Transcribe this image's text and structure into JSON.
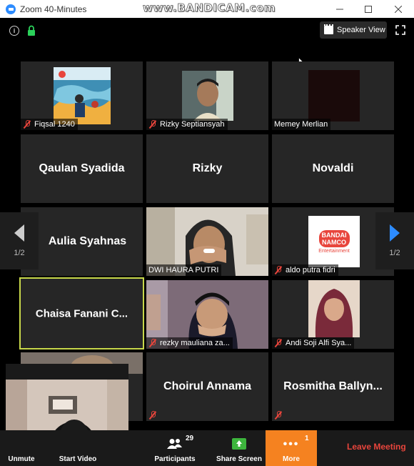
{
  "window": {
    "title": "Zoom 40-Minutes",
    "watermark": "www.BANDICAM.com"
  },
  "top_controls": {
    "speaker_view_label": "Speaker View"
  },
  "pager": {
    "left_label": "1/2",
    "right_label": "1/2"
  },
  "participants": [
    {
      "name": "Fiqsal 1240",
      "muted": true,
      "video": true
    },
    {
      "name": "Rizky Septiansyah",
      "muted": true,
      "video": true
    },
    {
      "name": "Memey Merlian",
      "muted": false,
      "video": true
    },
    {
      "name": "Qaulan Syadida",
      "video": false
    },
    {
      "name": "Rizky",
      "video": false
    },
    {
      "name": "Novaldi",
      "video": false
    },
    {
      "name": "Aulia Syahnas",
      "video": false
    },
    {
      "name": "DWI HAURA PUTRI",
      "muted": false,
      "video": true
    },
    {
      "name": "aldo putra fidri",
      "muted": true,
      "video": true
    },
    {
      "name": "Chaisa Fanani C...",
      "video": false,
      "active_speaker": true
    },
    {
      "name": "rezky mauliana za...",
      "muted": true,
      "video": true
    },
    {
      "name": "Andi Soji Alfi Sya...",
      "muted": true,
      "video": true
    },
    {
      "name": "Choirul Annama",
      "video": false,
      "muted": true
    },
    {
      "name": "Rosmitha Ballyn...",
      "video": false,
      "muted": true
    }
  ],
  "logo_text": {
    "line1": "BANDAI",
    "line2": "NAMCO",
    "line3": "Entertainment"
  },
  "toolbar": {
    "unmute_label": "Unmute",
    "start_video_label": "Start Video",
    "participants_label": "Participants",
    "participants_count": "29",
    "share_screen_label": "Share Screen",
    "more_label": "More",
    "more_badge": "1",
    "leave_label": "Leave Meeting"
  },
  "colors": {
    "zoom_blue": "#2d8cff",
    "more_orange": "#f58220",
    "leave_red": "#e8453c",
    "muted_red": "#e8453c",
    "share_green": "#3db53d",
    "active_speaker": "#c8d84a"
  }
}
